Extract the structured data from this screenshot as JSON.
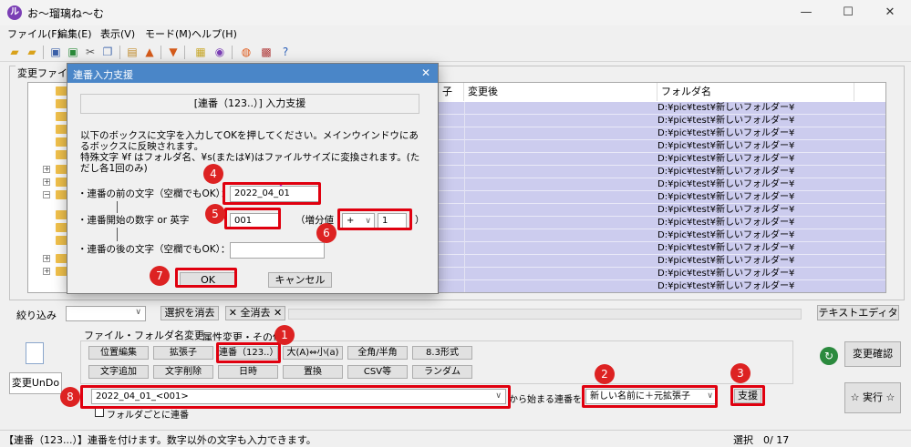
{
  "app": {
    "title": "お～瑠璃ね～む",
    "icon": "app-logo-icon"
  },
  "window_controls": {
    "minimize": "—",
    "maximize": "☐",
    "close": "✕"
  },
  "menu": [
    "ファイル(F)",
    "編集(E)",
    "表示(V)",
    "モード(M)",
    "ヘルプ(H)"
  ],
  "main": {
    "group_label": "変更ファイル",
    "table_headers": [
      "子",
      "変更後",
      "フォルダ名"
    ],
    "folder_path": "D:¥pic¥test¥新しいフォルダー¥",
    "row_count": 15
  },
  "filter": {
    "label": "絞り込み",
    "clear_select": "選択を消去",
    "clear_all": "✕ 全消去 ✕",
    "text_editor": "テキストエディタ"
  },
  "tabs": {
    "tab1": "ファイル・フォルダ名変更",
    "tab2": "属性変更・その他"
  },
  "tool_buttons": {
    "row1": [
      "位置編集",
      "拡張子",
      "連番（123..）",
      "大(A)⇔小(a)",
      "全角/半角",
      "8.3形式"
    ],
    "row2": [
      "文字追加",
      "文字削除",
      "日時",
      "置換",
      "CSV等",
      "ランダム"
    ]
  },
  "left_panel": {
    "undo": "変更UnDo"
  },
  "bottom": {
    "pattern_value": "2022_04_01_<001>",
    "suffix_text": "から始まる連番を",
    "mode_value": "新しい名前に＋元拡張子",
    "apply": "支援",
    "per_folder_check": "フォルダごとに連番",
    "confirm": "変更確認",
    "run": "☆ 実行 ☆"
  },
  "status": {
    "message": "【連番（123...）】連番を付けます。数字以外の文字も入力できます。",
    "selection": "選択　0/  17"
  },
  "dialog": {
    "title": "連番入力支援",
    "header": "[連番（123..）] 入力支援",
    "desc1": "以下のボックスに文字を入力してOKを押してください。メインウインドウにあるボックスに反映されます。",
    "desc2": "特殊文字 ¥f はフォルダ名、¥s(または¥)はファイルサイズに変換されます。(ただし各1回のみ)",
    "before_label": "・連番の前の文字（空欄でもOK）：",
    "before_value": "2022_04_01",
    "start_label": "・連番開始の数字 or 英字",
    "start_value": "001",
    "increment_label": "（増分値",
    "increment_sign": "+",
    "increment_value": "1",
    "increment_close": "）",
    "after_label": "・連番の後の文字（空欄でもOK）：",
    "after_value": "",
    "ok": "OK",
    "cancel": "キャンセル"
  },
  "badges": [
    "1",
    "2",
    "3",
    "4",
    "5",
    "6",
    "7",
    "8"
  ],
  "colors": {
    "highlight": "#e0000f",
    "selected_row": "#ccccee",
    "dialog_title": "#4a86c8"
  }
}
